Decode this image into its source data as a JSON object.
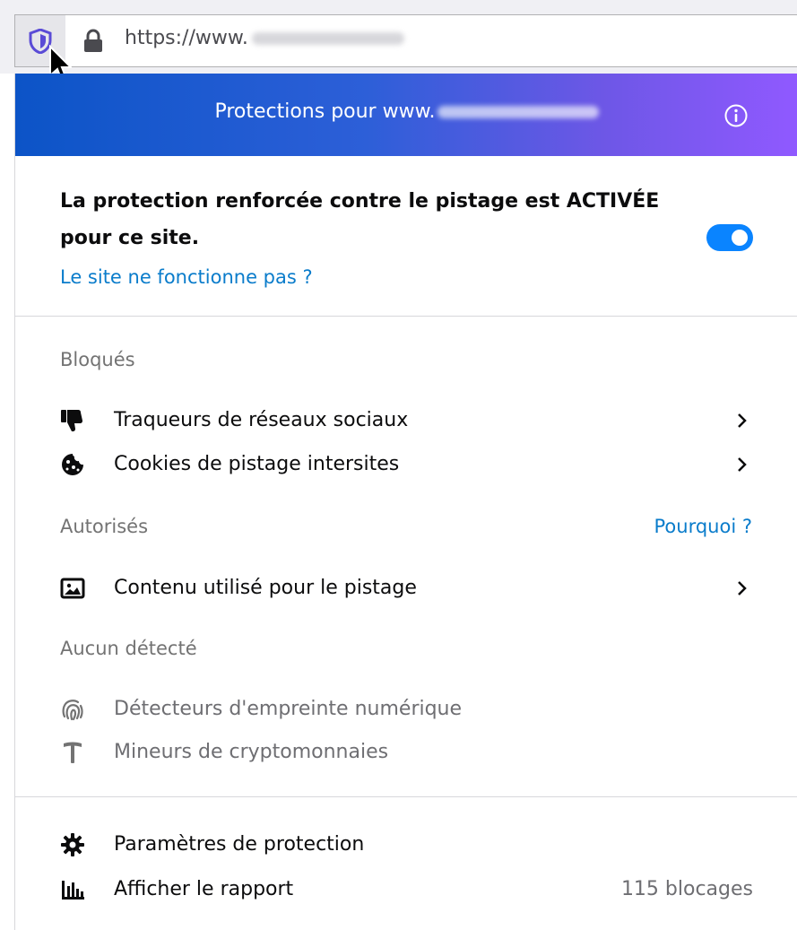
{
  "urlbar": {
    "url_prefix": "https://www.",
    "icons": {
      "shield": "shield-icon",
      "lock": "lock-icon",
      "cursor": "mouse-pointer-icon"
    }
  },
  "panel": {
    "header": {
      "title_prefix": "Protections pour www.",
      "info_icon": "info-icon"
    },
    "status": {
      "text": "La protection renforcée contre le pistage est ACTIVÉE pour ce site.",
      "toggle_on": true,
      "broken_link": "Le site ne fonctionne pas ?"
    },
    "sections": {
      "blocked": {
        "label": "Bloqués",
        "items": [
          {
            "label": "Traqueurs de réseaux sociaux",
            "icon": "thumbs-down-icon"
          },
          {
            "label": "Cookies de pistage intersites",
            "icon": "cookie-icon"
          }
        ]
      },
      "allowed": {
        "label": "Autorisés",
        "why_link": "Pourquoi ?",
        "items": [
          {
            "label": "Contenu utilisé pour le pistage",
            "icon": "image-icon"
          }
        ]
      },
      "none_detected": {
        "label": "Aucun détecté",
        "items": [
          {
            "label": "Détecteurs d'empreinte numérique",
            "icon": "fingerprint-icon"
          },
          {
            "label": "Mineurs de cryptomonnaies",
            "icon": "pickaxe-icon"
          }
        ]
      }
    },
    "footer": {
      "settings_label": "Paramètres de protection",
      "report_label": "Afficher le rapport",
      "blocked_count": "115 blocages"
    }
  },
  "colors": {
    "header_gradient_start": "#0c54c7",
    "header_gradient_end": "#9059ff",
    "link": "#0a7ccb",
    "toggle": "#0a84ff",
    "muted_text": "#737373"
  }
}
